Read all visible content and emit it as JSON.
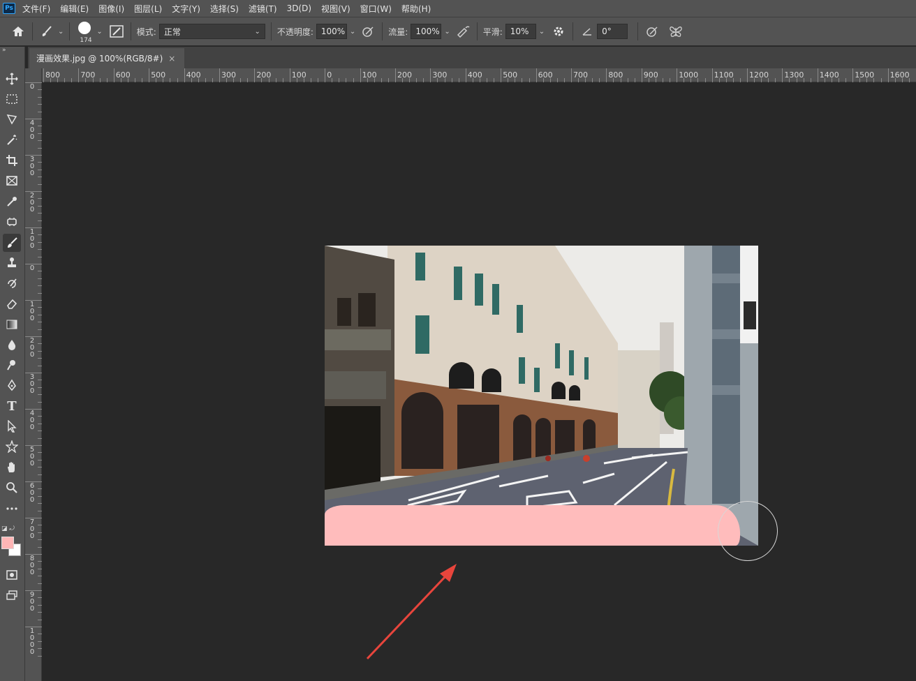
{
  "app": {
    "logo": "Ps"
  },
  "menubar": {
    "items": [
      "文件(F)",
      "编辑(E)",
      "图像(I)",
      "图层(L)",
      "文字(Y)",
      "选择(S)",
      "滤镜(T)",
      "3D(D)",
      "视图(V)",
      "窗口(W)",
      "帮助(H)"
    ]
  },
  "options_bar": {
    "brush_size": "174",
    "mode_label": "模式:",
    "mode_value": "正常",
    "opacity_label": "不透明度:",
    "opacity_value": "100%",
    "flow_label": "流量:",
    "flow_value": "100%",
    "smoothing_label": "平滑:",
    "smoothing_value": "10%",
    "angle_value": "0°"
  },
  "document": {
    "tab_title": "漫画效果.jpg @ 100%(RGB/8#)",
    "tab_close": "×"
  },
  "rulers": {
    "top_labels": [
      "800",
      "700",
      "600",
      "500",
      "400",
      "300",
      "200",
      "100",
      "0",
      "100",
      "200",
      "300",
      "400",
      "500",
      "600",
      "700",
      "800",
      "900",
      "1000",
      "1100",
      "1200",
      "1300",
      "1400",
      "1500",
      "1600"
    ],
    "left_labels": [
      "0",
      "400",
      "300",
      "200",
      "100",
      "0",
      "100",
      "200",
      "300",
      "400",
      "500",
      "600",
      "700",
      "800",
      "900",
      "1000"
    ]
  },
  "toolbar": {
    "collapse": "»",
    "tools": [
      "move-icon",
      "marquee-icon",
      "lasso-icon",
      "magic-wand-icon",
      "crop-icon",
      "frame-icon",
      "eyedropper-icon",
      "healing-icon",
      "brush-icon",
      "stamp-icon",
      "history-brush-icon",
      "eraser-icon",
      "gradient-icon",
      "blur-icon",
      "dodge-icon",
      "pen-icon",
      "type-icon",
      "path-select-icon",
      "shape-icon",
      "hand-icon",
      "zoom-icon",
      "more-icon"
    ],
    "active_tool": "brush-icon",
    "foreground_color": "#ffb6b6",
    "background_color": "#ffffff"
  },
  "colors": {
    "panel": "#535353",
    "canvas_bg": "#282828",
    "stroke_pink": "#ffbcbc",
    "arrow_red": "#e8453c"
  }
}
